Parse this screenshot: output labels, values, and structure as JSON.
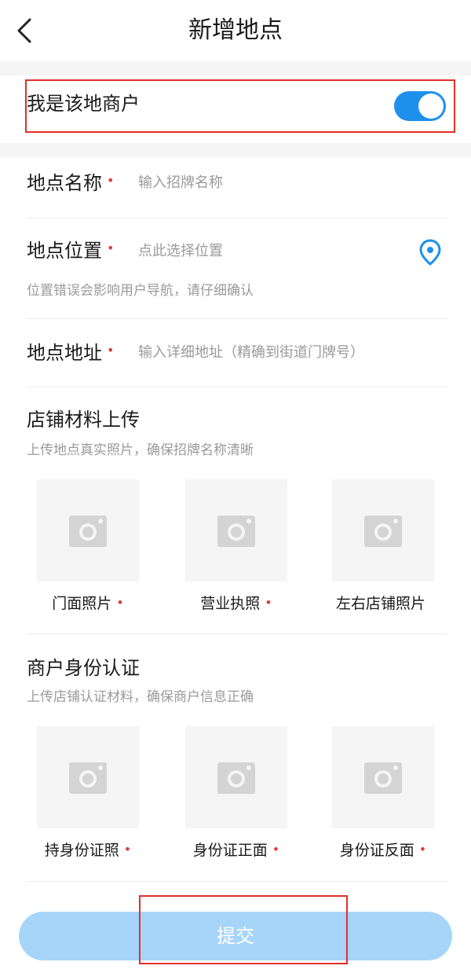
{
  "header": {
    "title": "新增地点"
  },
  "merchant": {
    "label": "我是该地商户",
    "toggle_on": true,
    "accent": "#1e90ec"
  },
  "fields": {
    "name": {
      "label": "地点名称",
      "required_mark": "•",
      "placeholder": "输入招牌名称"
    },
    "location": {
      "label": "地点位置",
      "required_mark": "•",
      "placeholder": "点此选择位置",
      "hint": "位置错误会影响用户导航，请仔细确认"
    },
    "address": {
      "label": "地点地址",
      "required_mark": "•",
      "placeholder": "输入详细地址（精确到街道门牌号）"
    }
  },
  "store_materials": {
    "title": "店铺材料上传",
    "subtitle": "上传地点真实照片，确保招牌名称清晰",
    "photos": [
      {
        "label": "门面照片",
        "required_mark": "•"
      },
      {
        "label": "营业执照",
        "required_mark": "•"
      },
      {
        "label": "左右店铺照片",
        "required_mark": ""
      }
    ]
  },
  "identity": {
    "title": "商户身份认证",
    "subtitle": "上传店铺认证材料，确保商户信息正确",
    "photos": [
      {
        "label": "持身份证照",
        "required_mark": "•"
      },
      {
        "label": "身份证正面",
        "required_mark": "•"
      },
      {
        "label": "身份证反面",
        "required_mark": "•"
      }
    ]
  },
  "submit": {
    "label": "提交",
    "color": "#a6d5f9"
  },
  "colors": {
    "required": "#e23b3b",
    "highlight_box": "#e0302a"
  }
}
